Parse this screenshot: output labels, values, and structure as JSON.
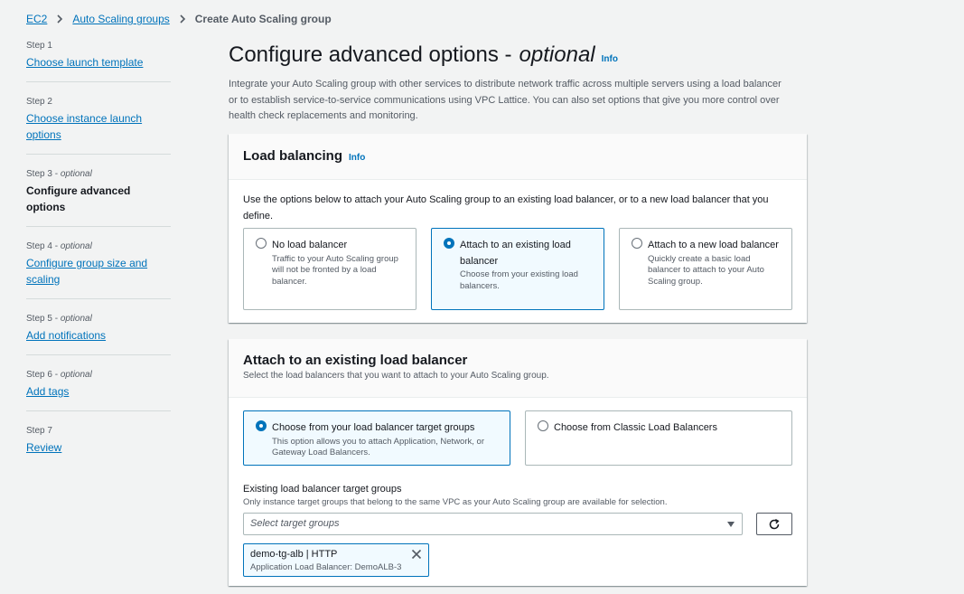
{
  "breadcrumb": {
    "items": [
      "EC2",
      "Auto Scaling groups"
    ],
    "current": "Create Auto Scaling group"
  },
  "steps": [
    {
      "label": "Step 1",
      "optional": "",
      "name": "Choose launch template"
    },
    {
      "label": "Step 2",
      "optional": "",
      "name": "Choose instance launch options"
    },
    {
      "label": "Step 3 - ",
      "optional": "optional",
      "name": "Configure advanced options"
    },
    {
      "label": "Step 4 - ",
      "optional": "optional",
      "name": "Configure group size and scaling"
    },
    {
      "label": "Step 5 - ",
      "optional": "optional",
      "name": "Add notifications"
    },
    {
      "label": "Step 6 - ",
      "optional": "optional",
      "name": "Add tags"
    },
    {
      "label": "Step 7",
      "optional": "",
      "name": "Review"
    }
  ],
  "page": {
    "title": "Configure advanced options -",
    "title_optional": "optional",
    "info": "Info",
    "intro": "Integrate your Auto Scaling group with other services to distribute network traffic across multiple servers using a load balancer or to establish service-to-service communications using VPC Lattice. You can also set options that give you more control over health check replacements and monitoring."
  },
  "load_balancing": {
    "title": "Load balancing",
    "info": "Info",
    "text": "Use the options below to attach your Auto Scaling group to an existing load balancer, or to a new load balancer that you define.",
    "options": [
      {
        "title": "No load balancer",
        "desc": "Traffic to your Auto Scaling group will not be fronted by a load balancer."
      },
      {
        "title": "Attach to an existing load balancer",
        "desc": "Choose from your existing load balancers."
      },
      {
        "title": "Attach to a new load balancer",
        "desc": "Quickly create a basic load balancer to attach to your Auto Scaling group."
      }
    ],
    "selected_index": 1
  },
  "existing_lb": {
    "title": "Attach to an existing load balancer",
    "desc": "Select the load balancers that you want to attach to your Auto Scaling group.",
    "options": [
      {
        "title": "Choose from your load balancer target groups",
        "desc": "This option allows you to attach Application, Network, or Gateway Load Balancers."
      },
      {
        "title": "Choose from Classic Load Balancers",
        "desc": ""
      }
    ],
    "selected_index": 0,
    "field_label": "Existing load balancer target groups",
    "field_desc": "Only instance target groups that belong to the same VPC as your Auto Scaling group are available for selection.",
    "select_placeholder": "Select target groups",
    "token": {
      "title": "demo-tg-alb | HTTP",
      "desc": "Application Load Balancer: DemoALB-3"
    }
  },
  "colors": {
    "link": "#0073bb",
    "selected_bg": "#f1faff",
    "page_bg": "#f2f3f3"
  }
}
